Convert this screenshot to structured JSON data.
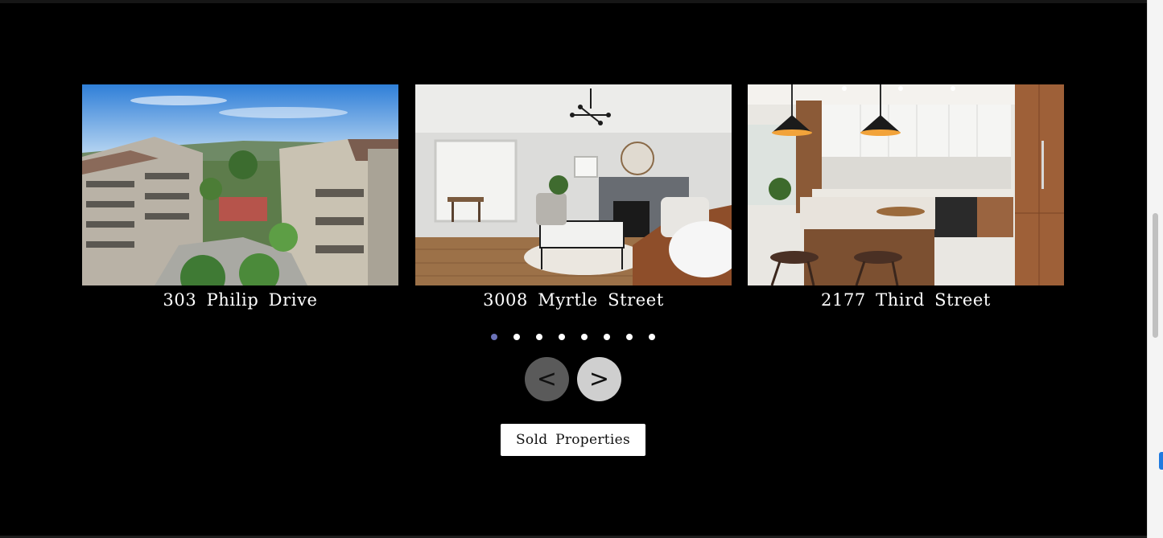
{
  "carousel": {
    "slides": [
      {
        "address": "303 Philip Drive"
      },
      {
        "address": "3008 Myrtle Street"
      },
      {
        "address": "2177 Third Street"
      }
    ],
    "dot_count": 8,
    "active_dot": 1,
    "prev_label": "<",
    "next_label": ">"
  },
  "sold_button": {
    "label": "Sold Properties"
  }
}
